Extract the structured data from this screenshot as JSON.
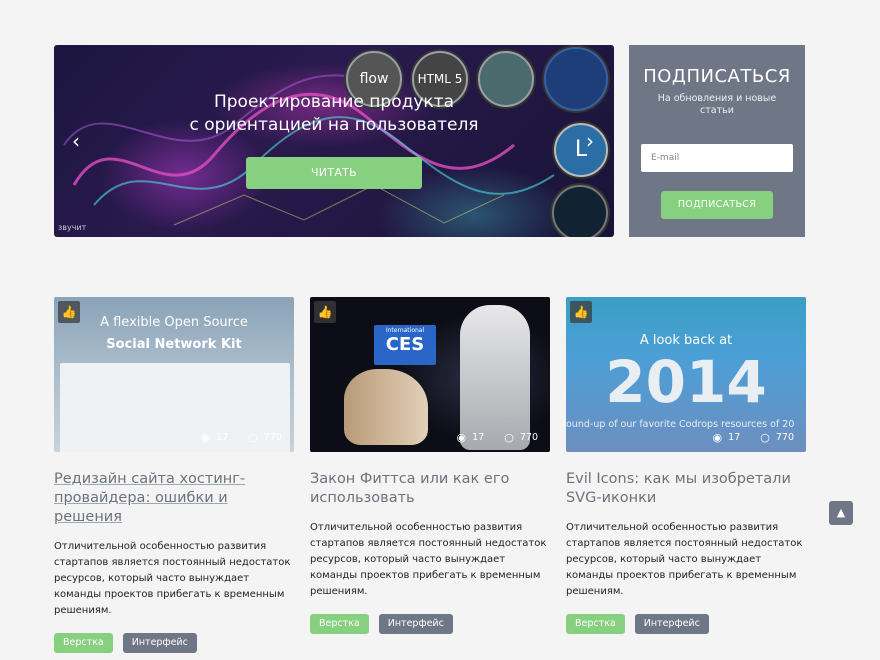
{
  "hero": {
    "title_line1": "Проектирование продукта",
    "title_line2": "с ориентацией на пользователя",
    "button_label": "ЧИТАТЬ",
    "prev_arrow": "‹",
    "next_arrow": "›",
    "badges": [
      "flow",
      "HTML 5"
    ],
    "watermark": "звучит"
  },
  "subscribe": {
    "title": "ПОДПИСАТЬСЯ",
    "text": "На обновления и новые статьи",
    "email_placeholder": "E-mail",
    "button_label": "ПОДПИСАТЬСЯ"
  },
  "cards": [
    {
      "image_caption_line1": "A flexible Open Source",
      "image_caption_line2": "Social Network Kit",
      "views": "17",
      "comments": "770",
      "title": "Редизайн сайта хостинг-провайдера: ошибки и решения",
      "text": "Отличительной особенностью развития стартапов является постоянный недостаток ресурсов, который часто вынуждает команды проектов прибегать к временным решениям.",
      "tags": [
        "Верстка",
        "Интерфейс"
      ]
    },
    {
      "image_caption_line1": "International",
      "image_caption_line2": "CES",
      "views": "17",
      "comments": "770",
      "title": "Закон Фиттса или как его использовать",
      "text": "Отличительной особенностью развития стартапов является постоянный недостаток ресурсов, который часто вынуждает команды проектов прибегать к временным решениям.",
      "tags": [
        "Верстка",
        "Интерфейс"
      ]
    },
    {
      "image_caption_line1": "A look back at",
      "image_caption_line2": "2014",
      "image_caption_line3": "ound-up of our favorite Codrops resources of 20",
      "views": "17",
      "comments": "770",
      "title": "Evil Icons: как мы изобретали SVG-иконки",
      "text": "Отличительной особенностью развития стартапов является постоянный недостаток ресурсов, который часто вынуждает команды проектов прибегать к временным решениям.",
      "tags": [
        "Верстка",
        "Интерфейс"
      ]
    }
  ],
  "scroll_top": "▲",
  "colors": {
    "accent_green": "#86d07f",
    "slate": "#6f7786",
    "background": "#f4f4f4"
  }
}
